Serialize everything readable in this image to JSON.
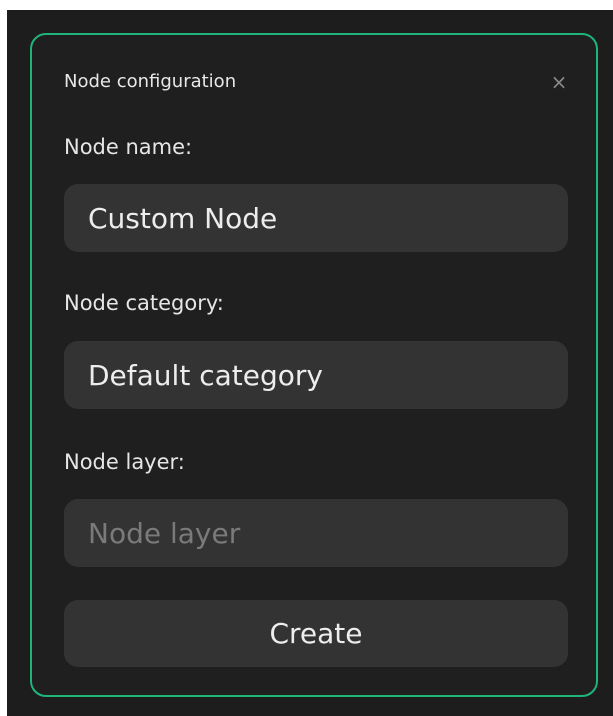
{
  "colors": {
    "accent_border": "#1fb57a",
    "dialog_bg": "#1f1f1f",
    "field_bg": "#333333"
  },
  "dialog": {
    "title": "Node configuration",
    "close_icon": "close-icon",
    "close_glyph": "×"
  },
  "fields": {
    "name": {
      "label": "Node name:",
      "value": "Custom Node",
      "placeholder": ""
    },
    "category": {
      "label": "Node category:",
      "value": "Default category",
      "placeholder": ""
    },
    "layer": {
      "label": "Node layer:",
      "value": "",
      "placeholder": "Node layer"
    }
  },
  "actions": {
    "create_label": "Create"
  }
}
